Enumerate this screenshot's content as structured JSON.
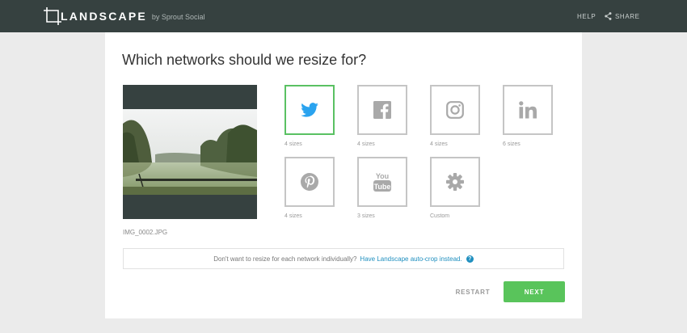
{
  "header": {
    "logo_text": "LANDSCAPE",
    "logo_by": "by Sprout Social",
    "help_label": "HELP",
    "share_label": "SHARE"
  },
  "main": {
    "title": "Which networks should we resize for?",
    "filename": "IMG_0002.JPG",
    "networks": [
      {
        "name": "twitter-icon",
        "sizes": "4 sizes",
        "selected": true
      },
      {
        "name": "facebook-icon",
        "sizes": "4 sizes",
        "selected": false
      },
      {
        "name": "instagram-icon",
        "sizes": "4 sizes",
        "selected": false
      },
      {
        "name": "linkedin-icon",
        "sizes": "6 sizes",
        "selected": false
      },
      {
        "name": "pinterest-icon",
        "sizes": "4 sizes",
        "selected": false
      },
      {
        "name": "youtube-icon",
        "sizes": "3 sizes",
        "selected": false
      },
      {
        "name": "gear-icon",
        "sizes": "Custom",
        "selected": false
      }
    ],
    "autocrop_question": "Don't want to resize for each network individually?",
    "autocrop_link": "Have Landscape auto-crop instead.",
    "restart_label": "RESTART",
    "next_label": "NEXT"
  },
  "colors": {
    "topbar": "#364140",
    "accent_green": "#59c45b",
    "link_blue": "#1f8fbf",
    "twitter_blue": "#2aa3ef",
    "icon_gray": "#a9a9a9"
  }
}
